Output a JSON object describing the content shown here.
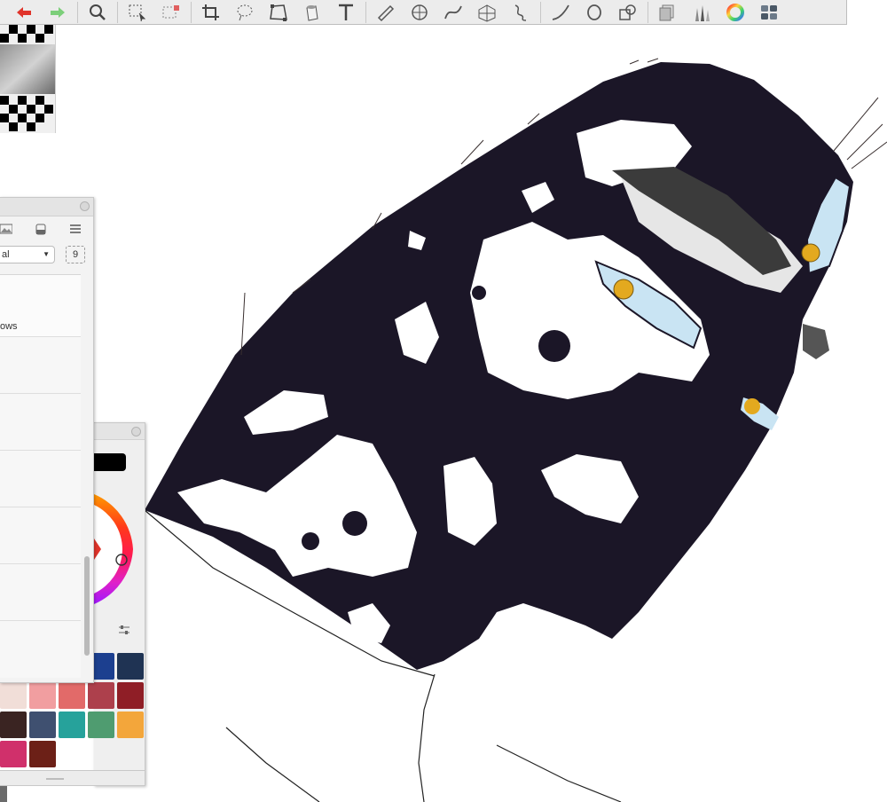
{
  "app": {
    "toolbar": {
      "tools": [
        {
          "name": "undo-icon",
          "color": "#e0342b"
        },
        {
          "name": "redo-icon",
          "color": "#7ccf7a"
        },
        {
          "name": "zoom-icon"
        },
        {
          "name": "selection-icon"
        },
        {
          "name": "selection-options-icon"
        },
        {
          "name": "crop-icon"
        },
        {
          "name": "lasso-icon"
        },
        {
          "name": "transform-icon"
        },
        {
          "name": "fill-bucket-icon"
        },
        {
          "name": "text-tool-icon",
          "glyph": "T"
        },
        {
          "name": "ruler-icon"
        },
        {
          "name": "symmetry-icon"
        },
        {
          "name": "curve-icon"
        },
        {
          "name": "perspective-grid-icon"
        },
        {
          "name": "style-icon"
        },
        {
          "name": "stroke-icon"
        },
        {
          "name": "ellipse-icon"
        },
        {
          "name": "shape-icon"
        },
        {
          "name": "layers-icon"
        },
        {
          "name": "brush-library-icon"
        },
        {
          "name": "color-wheel-icon"
        },
        {
          "name": "color-swatches-icon"
        }
      ]
    },
    "layers_panel": {
      "blend_mode": "al",
      "opacity_value": "9",
      "layer_names": [
        "",
        "ows",
        "",
        "",
        "",
        "",
        ""
      ]
    },
    "color_panel": {
      "current_color": "#000000"
    },
    "swatches": [
      {
        "row": 0,
        "col": 3,
        "color": "#1c3f8f"
      },
      {
        "row": 0,
        "col": 4,
        "color": "#1f3353"
      },
      {
        "row": 1,
        "col": 0,
        "color": "#f1ded8"
      },
      {
        "row": 1,
        "col": 1,
        "color": "#f19ea0"
      },
      {
        "row": 1,
        "col": 2,
        "color": "#e26a69"
      },
      {
        "row": 1,
        "col": 3,
        "color": "#ad404c"
      },
      {
        "row": 1,
        "col": 4,
        "color": "#8f1e26"
      },
      {
        "row": 2,
        "col": 0,
        "color": "#3a2422"
      },
      {
        "row": 2,
        "col": 1,
        "color": "#3f5070"
      },
      {
        "row": 2,
        "col": 2,
        "color": "#26a29b"
      },
      {
        "row": 2,
        "col": 3,
        "color": "#4f9c70"
      },
      {
        "row": 2,
        "col": 4,
        "color": "#f3a63b"
      },
      {
        "row": 3,
        "col": 0,
        "color": "#d0306b"
      },
      {
        "row": 3,
        "col": 1,
        "color": "#6c2017"
      }
    ],
    "artwork": {
      "skin_dark": "#1b1627",
      "skin_light": "#ffffff",
      "iris_color": "#e3a91f",
      "sclera_color": "#c9e4f3"
    }
  }
}
